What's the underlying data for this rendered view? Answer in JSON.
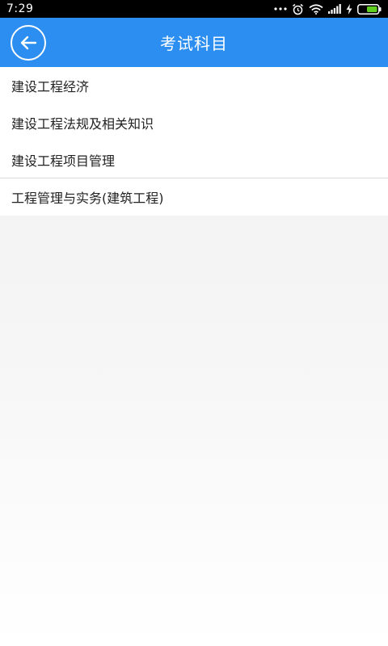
{
  "status_bar": {
    "time": "7:29",
    "icons": [
      "more-dots-icon",
      "alarm-clock-icon",
      "wifi-icon",
      "signal-icon",
      "charging-bolt-icon",
      "battery-icon"
    ]
  },
  "header": {
    "title": "考试科目",
    "back_icon": "arrow-left-icon",
    "background_color": "#2b8ef0"
  },
  "subjects": [
    {
      "label": "建设工程经济"
    },
    {
      "label": "建设工程法规及相关知识"
    },
    {
      "label": "建设工程项目管理"
    },
    {
      "label": "工程管理与实务(建筑工程)"
    }
  ]
}
